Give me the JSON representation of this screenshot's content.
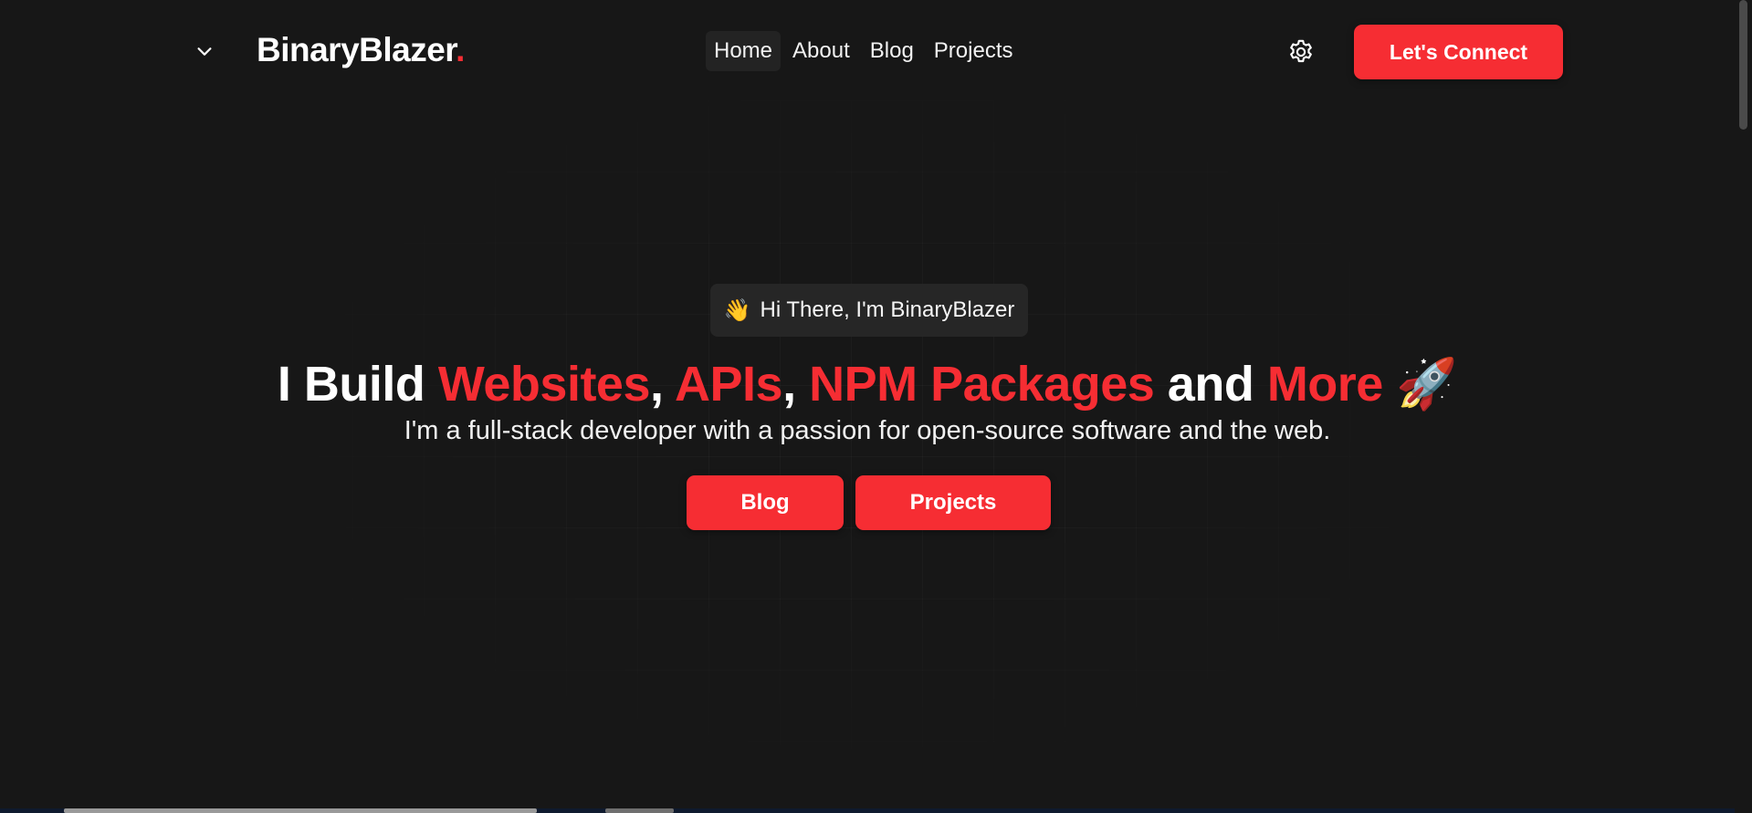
{
  "header": {
    "menu_icon": "chevron-down-icon",
    "logo_text": "BinaryBlazer",
    "logo_dot": ".",
    "nav": [
      {
        "label": "Home",
        "active": true
      },
      {
        "label": "About",
        "active": false
      },
      {
        "label": "Blog",
        "active": false
      },
      {
        "label": "Projects",
        "active": false
      }
    ],
    "settings_icon": "gear-icon",
    "connect_label": "Let's Connect"
  },
  "hero": {
    "badge_emoji": "👋",
    "badge_text": "Hi There, I'm BinaryBlazer",
    "headline": {
      "prefix": "I Build ",
      "item1": "Websites",
      "sep1": ", ",
      "item2": "APIs",
      "sep2": ", ",
      "item3": "NPM Packages",
      "and": " and ",
      "item4": "More",
      "emoji": " 🚀"
    },
    "subline": "I'm a full-stack developer with a passion for open-source software and the web.",
    "buttons": {
      "blog": "Blog",
      "projects": "Projects"
    }
  },
  "colors": {
    "background": "#171717",
    "accent": "#f62d33",
    "badge_bg": "#262626",
    "text": "#ffffff"
  }
}
